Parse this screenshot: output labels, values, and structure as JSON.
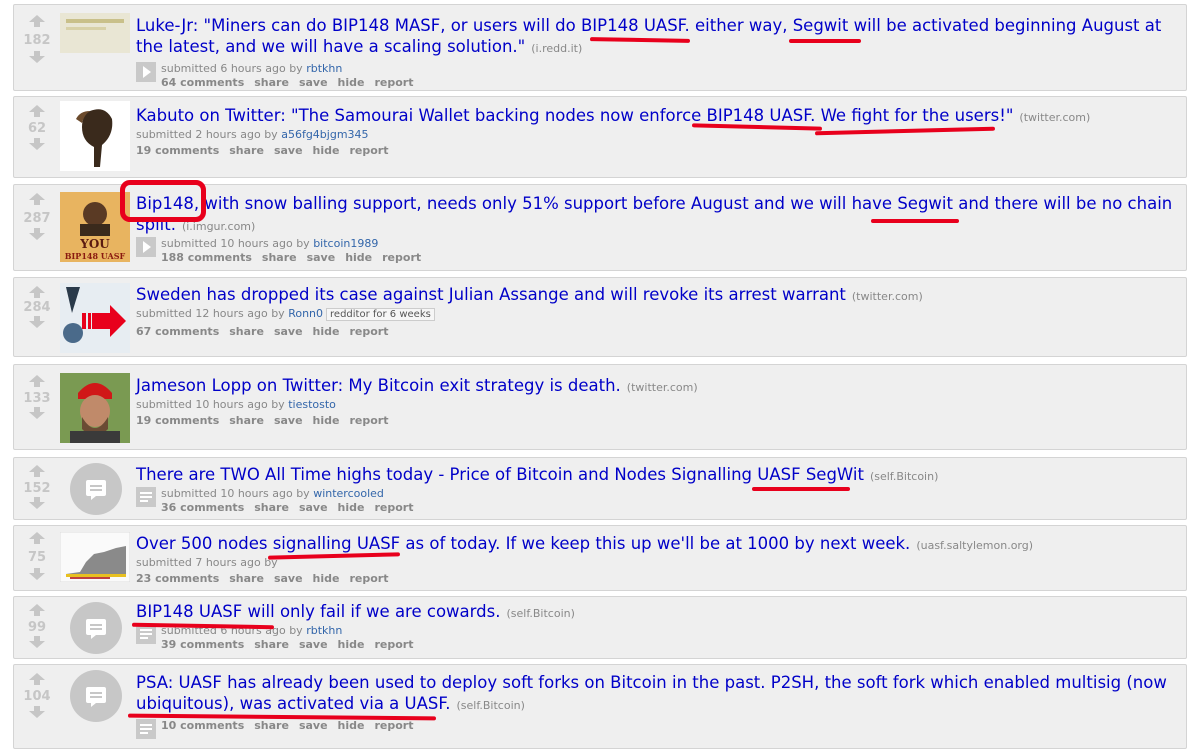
{
  "colors": {
    "link": "#0000c8",
    "mark": "#e8001c",
    "score": "#c6c6c6"
  },
  "posts": [
    {
      "score": "182",
      "title": "Luke-Jr: \"Miners can do BIP148 MASF, or users will do BIP148 UASF. either way, Segwit will be activated beginning August at the latest, and we will have a scaling solution.\"",
      "domain": "(i.redd.it)",
      "submitted": "submitted 6 hours ago by",
      "author": "rbtkhn",
      "comments": "64 comments",
      "share": "share",
      "save": "save",
      "hide": "hide",
      "report": "report",
      "thumb": "image-thumbnail"
    },
    {
      "score": "62",
      "title": "Kabuto on Twitter: \"The Samourai Wallet backing nodes now enforce BIP148 UASF. We fight for the users!\"",
      "domain": "(twitter.com)",
      "submitted": "submitted 2 hours ago by",
      "author": "a56fg4bjgm345",
      "comments": "19 comments",
      "share": "share",
      "save": "save",
      "hide": "hide",
      "report": "report",
      "thumb": "bird-thumbnail"
    },
    {
      "score": "287",
      "title": "Bip148, with snow balling support, needs only 51% support before August and we will have Segwit and there will be no chain split.",
      "domain": "(i.imgur.com)",
      "submitted": "submitted 10 hours ago by",
      "author": "bitcoin1989",
      "comments": "188 comments",
      "share": "share",
      "save": "save",
      "hide": "hide",
      "report": "report",
      "thumb_text": [
        "YOU",
        "BIP148 UASF"
      ]
    },
    {
      "score": "284",
      "title": "Sweden has dropped its case against Julian Assange and will revoke its arrest warrant",
      "domain": "(twitter.com)",
      "submitted": "submitted 12 hours ago by",
      "author": "Ronn0",
      "flair": "redditor for 6 weeks",
      "comments": "67 comments",
      "share": "share",
      "save": "save",
      "hide": "hide",
      "report": "report",
      "thumb": "wikileaks-thumbnail"
    },
    {
      "score": "133",
      "title": "Jameson Lopp on Twitter: My Bitcoin exit strategy is death.",
      "domain": "(twitter.com)",
      "submitted": "submitted 10 hours ago by",
      "author": "tiestosto",
      "comments": "19 comments",
      "share": "share",
      "save": "save",
      "hide": "hide",
      "report": "report",
      "thumb": "person-photo-thumbnail"
    },
    {
      "score": "152",
      "title": "There are TWO All Time highs today - Price of Bitcoin and Nodes Signalling UASF SegWit",
      "domain": "(self.Bitcoin)",
      "submitted": "submitted 10 hours ago by",
      "author": "wintercooled",
      "comments": "36 comments",
      "share": "share",
      "save": "save",
      "hide": "hide",
      "report": "report",
      "thumb": "self-post-icon"
    },
    {
      "score": "75",
      "title": "Over 500 nodes signalling UASF as of today. If we keep this up we'll be at 1000 by next week.",
      "domain": "(uasf.saltylemon.org)",
      "submitted": "submitted 7 hours ago by",
      "author": "",
      "comments": "23 comments",
      "share": "share",
      "save": "save",
      "hide": "hide",
      "report": "report",
      "thumb": "chart-thumbnail"
    },
    {
      "score": "99",
      "title": "BIP148 UASF will only fail if we are cowards.",
      "domain": "(self.Bitcoin)",
      "submitted": "submitted 6 hours ago by",
      "author": "rbtkhn",
      "comments": "39 comments",
      "share": "share",
      "save": "save",
      "hide": "hide",
      "report": "report",
      "thumb": "self-post-icon"
    },
    {
      "score": "104",
      "title": "PSA: UASF has already been used to deploy soft forks on Bitcoin in the past. P2SH, the soft fork which enabled multisig (now ubiquitous), was activated via a UASF.",
      "domain": "(self.Bitcoin)",
      "submitted": "",
      "author": "",
      "comments": "10 comments",
      "share": "share",
      "save": "save",
      "hide": "hide",
      "report": "report",
      "thumb": "self-post-icon"
    }
  ]
}
